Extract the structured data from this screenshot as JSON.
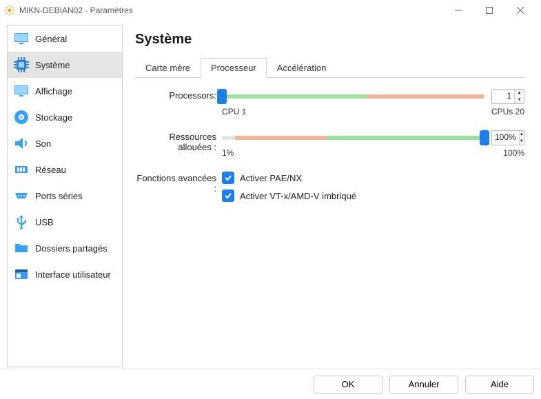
{
  "window": {
    "title": "MIKN-DEBIAN02 - Paramètres"
  },
  "sidebar": {
    "items": [
      {
        "id": "general",
        "label": "Général",
        "icon": "monitor",
        "selected": false
      },
      {
        "id": "system",
        "label": "Système",
        "icon": "chip",
        "selected": true
      },
      {
        "id": "display",
        "label": "Affichage",
        "icon": "monitor",
        "selected": false
      },
      {
        "id": "storage",
        "label": "Stockage",
        "icon": "disk",
        "selected": false
      },
      {
        "id": "audio",
        "label": "Son",
        "icon": "speaker",
        "selected": false
      },
      {
        "id": "network",
        "label": "Réseau",
        "icon": "nic",
        "selected": false
      },
      {
        "id": "serial",
        "label": "Ports séries",
        "icon": "serial",
        "selected": false
      },
      {
        "id": "usb",
        "label": "USB",
        "icon": "usb",
        "selected": false
      },
      {
        "id": "shared",
        "label": "Dossiers partagés",
        "icon": "folder",
        "selected": false
      },
      {
        "id": "ui",
        "label": "Interface utilisateur",
        "icon": "window",
        "selected": false
      }
    ]
  },
  "page": {
    "title": "Système",
    "tabs": [
      {
        "id": "motherboard",
        "label": "Carte mère",
        "active": false
      },
      {
        "id": "processor",
        "label": "Processeur",
        "active": true
      },
      {
        "id": "accel",
        "label": "Accélération",
        "active": false
      }
    ]
  },
  "processors": {
    "label": "Processors:",
    "value": "1",
    "min_label": "CPU 1",
    "max_label": "CPUs 20",
    "thumb_pct": 0,
    "track": [
      {
        "color": "green",
        "pct": 55
      },
      {
        "color": "orange",
        "pct": 45
      }
    ]
  },
  "resources": {
    "label": "Ressources allouées :",
    "value": "100%",
    "min_label": "1%",
    "max_label": "100%",
    "thumb_pct": 100,
    "track": [
      {
        "color": "gray",
        "pct": 5
      },
      {
        "color": "orange",
        "pct": 35
      },
      {
        "color": "green",
        "pct": 60
      }
    ]
  },
  "advanced": {
    "label": "Fonctions avancées :",
    "options": [
      {
        "id": "pae",
        "label": "Activer PAE/NX",
        "checked": true
      },
      {
        "id": "vtx",
        "label": "Activer VT-x/AMD-V imbriqué",
        "checked": true
      }
    ]
  },
  "footer": {
    "ok": "OK",
    "cancel": "Annuler",
    "help": "Aide"
  }
}
